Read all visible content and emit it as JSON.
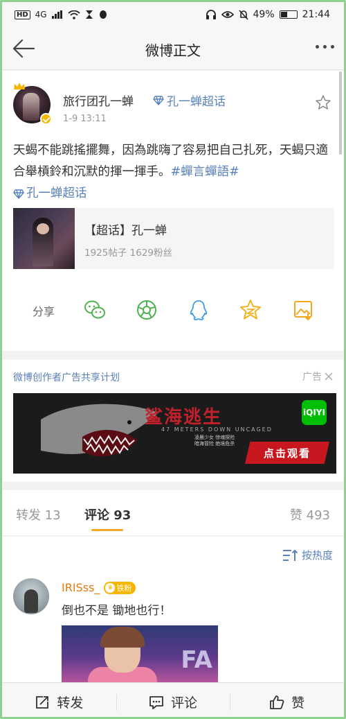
{
  "status_bar": {
    "network": "4G",
    "battery": "49%",
    "battery_level": 0.49,
    "time": "21:44"
  },
  "header": {
    "title": "微博正文"
  },
  "post": {
    "author": "旅行团孔一蝉",
    "super_topic_link": "孔一蝉超话",
    "time": "1-9 13:11",
    "text_main": "天蝎不能跳搖擺舞，因為跳嗨了容易把自己扎死，天蝎只適合舉槓鈴和沉默的揮一揮手。",
    "hashtag": "#蟬言蟬語#",
    "trailing_topic": "孔一蝉超话",
    "topic_card": {
      "name": "【超话】孔一蝉",
      "stats": "1925帖子 1629粉丝"
    },
    "share_label": "分享",
    "share_icons": [
      "wechat-icon",
      "moments-icon",
      "qq-icon",
      "qzone-icon",
      "save-image-icon"
    ]
  },
  "ad": {
    "title": "微博创作者广告共享计划",
    "label": "广告",
    "banner_logo": "鲨海逃生",
    "banner_sub": "47 METERS DOWN UNCAGED",
    "banner_copy_1": "凌晨少女 惊魂探险",
    "banner_copy_2": "暗海冒险 绝境危杀",
    "banner_brand": "iQIYI",
    "banner_cta": "点击观看"
  },
  "tabs": {
    "repost": "转发 13",
    "comment": "评论 93",
    "like": "赞 493"
  },
  "comments": {
    "sort_label": "按热度",
    "items": [
      {
        "user": "IRISss_",
        "badge": "铁粉",
        "text": "倒也不是 锄地也行！",
        "image_text": "FA"
      }
    ]
  },
  "bottom_bar": {
    "repost": "转发",
    "comment": "评论",
    "like": "赞"
  },
  "colors": {
    "link": "#5a82b9",
    "tab_accent": "#f5a623",
    "username": "#e8790a",
    "ad_cta": "#c8161e"
  }
}
